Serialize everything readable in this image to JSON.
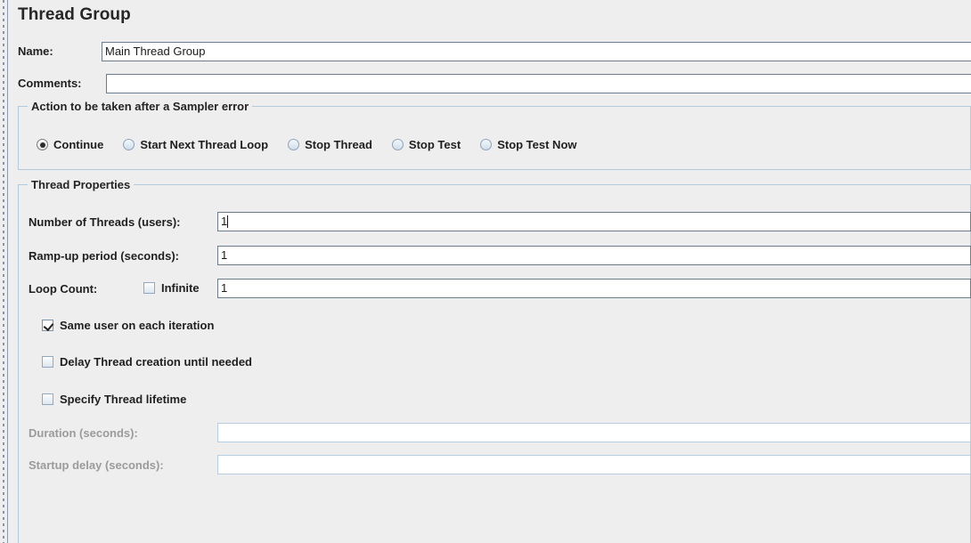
{
  "window": {
    "title": "Thread Group"
  },
  "split_pane": {
    "handle_name": "split-pane-drag-handle"
  },
  "top_fields": {
    "name": {
      "label": "Name:",
      "value": "Main Thread Group",
      "placeholder": ""
    },
    "comments": {
      "label": "Comments:",
      "value": "",
      "placeholder": ""
    }
  },
  "sampler_error_group": {
    "title": "Action to be taken after a Sampler error",
    "selected": "Continue",
    "options": [
      {
        "label": "Continue",
        "selected": true
      },
      {
        "label": "Start Next Thread Loop",
        "selected": false
      },
      {
        "label": "Stop Thread",
        "selected": false
      },
      {
        "label": "Stop Test",
        "selected": false
      },
      {
        "label": "Stop Test Now",
        "selected": false
      }
    ]
  },
  "thread_properties": {
    "title": "Thread Properties",
    "number_of_threads": {
      "label": "Number of Threads (users):",
      "value": "1",
      "enabled": true
    },
    "ramp_up_period": {
      "label": "Ramp-up period (seconds):",
      "value": "1",
      "enabled": true
    },
    "loop_count": {
      "label": "Loop Count:",
      "value": "1",
      "enabled": true,
      "infinite": {
        "label": "Infinite",
        "checked": false
      }
    },
    "checkboxes": [
      {
        "label": "Same user on each iteration",
        "checked": true
      },
      {
        "label": "Delay Thread creation until needed",
        "checked": false
      },
      {
        "label": "Specify Thread lifetime",
        "checked": false
      }
    ],
    "duration": {
      "label": "Duration (seconds):",
      "value": "",
      "enabled": false
    },
    "startup_delay": {
      "label": "Startup delay (seconds):",
      "value": "",
      "enabled": false
    }
  },
  "colors": {
    "background": "#eeeeee",
    "group_border": "#b5c9dd",
    "field_border": "#6b7c8f",
    "field_border_disabled": "#b9cde1",
    "text": "#1f1f1f",
    "text_disabled": "#9b9b9b"
  }
}
